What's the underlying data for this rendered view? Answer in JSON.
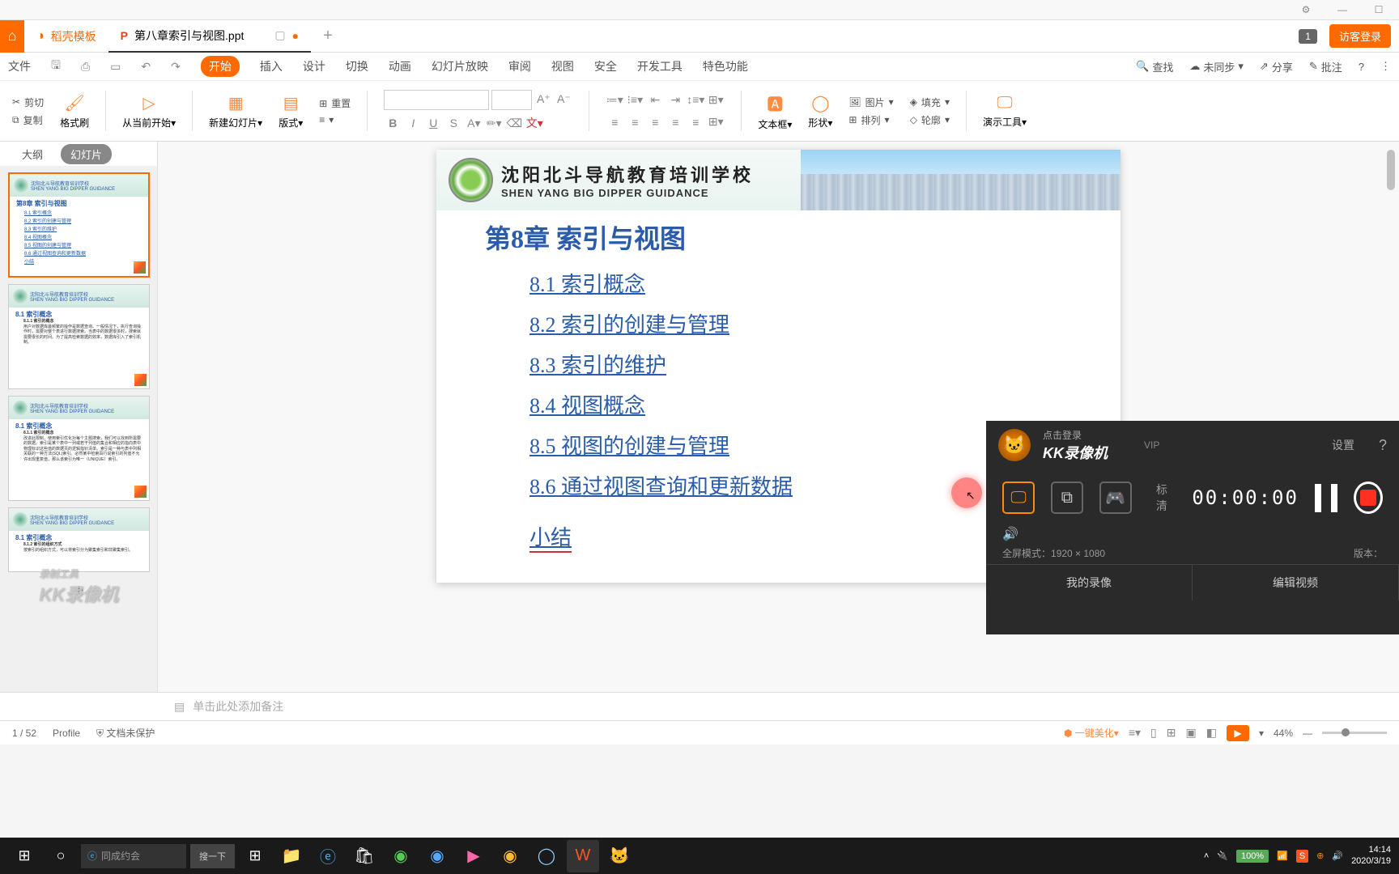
{
  "tabs": {
    "template": "稻壳模板",
    "doc": "第八章索引与视图.ppt",
    "badge": "1",
    "guest": "访客登录"
  },
  "menu": {
    "file": "文件",
    "start": "开始",
    "insert": "插入",
    "design": "设计",
    "transition": "切换",
    "animation": "动画",
    "slideshow": "幻灯片放映",
    "review": "审阅",
    "view": "视图",
    "security": "安全",
    "devtools": "开发工具",
    "special": "特色功能",
    "search": "查找",
    "notsync": "未同步",
    "share": "分享",
    "annotate": "批注"
  },
  "ribbon": {
    "cut": "剪切",
    "copy": "复制",
    "fmtpaint": "格式刷",
    "fromstart": "从当前开始",
    "newslide": "新建幻灯片",
    "layout": "版式",
    "reset": "重置",
    "textbox": "文本框",
    "shapes": "形状",
    "image": "图片",
    "arrange": "排列",
    "fill": "填充",
    "outline": "轮廓",
    "present": "演示工具"
  },
  "sidebar": {
    "outline": "大纲",
    "slides": "幻灯片"
  },
  "slide": {
    "school_cn": "沈阳北斗导航教育培训学校",
    "school_en": "SHEN YANG BIG DIPPER GUIDANCE",
    "title": "第8章  索引与视图",
    "links": [
      "8.1  索引概念",
      "8.2  索引的创建与管理",
      "8.3  索引的维护",
      "8.4  视图概念",
      "8.5  视图的创建与管理",
      "8.6  通过视图查询和更新数据",
      "小结"
    ]
  },
  "thumb1": {
    "title": "第8章  索引与视图",
    "l1": "8.1  索引概念",
    "l2": "8.2  索引的创建与管理",
    "l3": "8.3  索引的维护",
    "l4": "8.4  视图概念",
    "l5": "8.5  视图的创建与管理",
    "l6": "8.6  通过视图查询和更新数据",
    "l7": "小结"
  },
  "thumb2": {
    "title": "8.1  索引概念",
    "sub": "8.1.1 索引的概念",
    "text": "用户对数据库最频繁的操作是数据查询。一般情况下，执行查询操作时，需要对整个表进行数据搜索。当表中的数据很多时，搜索就需要很长的时间。为了提高检索数据的效率，数据库引入了索引机制。"
  },
  "thumb3": {
    "title": "8.1  索引概念",
    "sub": "8.1.1 索引的概念",
    "text": "改进此限制，使用索引优化对每个主题搜索，我们可以找到所需要的数据。索引是某个表中一列或若干列值的集合和相应的指向表中物理标识这些值的数据页的逻辑指针清单。索引是一种与表中列相关联的一种方法(SQL)索引。必然某中检索百行说索引的列值不允许出现重复值，那么该索引为唯一（UNIQUE）索引。"
  },
  "thumb4": {
    "title": "8.1  索引概念",
    "sub": "8.1.2 索引的组织方式",
    "text": "按索引的组织方式，可以将索引分为聚集索引和非聚集索引。"
  },
  "notes": "单击此处添加备注",
  "status": {
    "page": "1 / 52",
    "profile": "Profile",
    "protect": "文档未保护",
    "beautify": "一键美化",
    "zoom": "44%"
  },
  "kk": {
    "login": "点击登录",
    "brand": "KK录像机",
    "vip": "VIP",
    "settings": "设置",
    "quality": "标清",
    "timer": "00:00:00",
    "mode": "全屏模式：",
    "res": "1920 × 1080",
    "version": "版本：",
    "myrec": "我的录像",
    "editvid": "编辑视频"
  },
  "taskbar": {
    "search_text": "同成约会",
    "search_btn": "搜一下",
    "battery": "100%",
    "time": "14:14",
    "date": "2020/3/19"
  },
  "watermark": {
    "line1": "录制工具",
    "line2": "KK录像机"
  }
}
